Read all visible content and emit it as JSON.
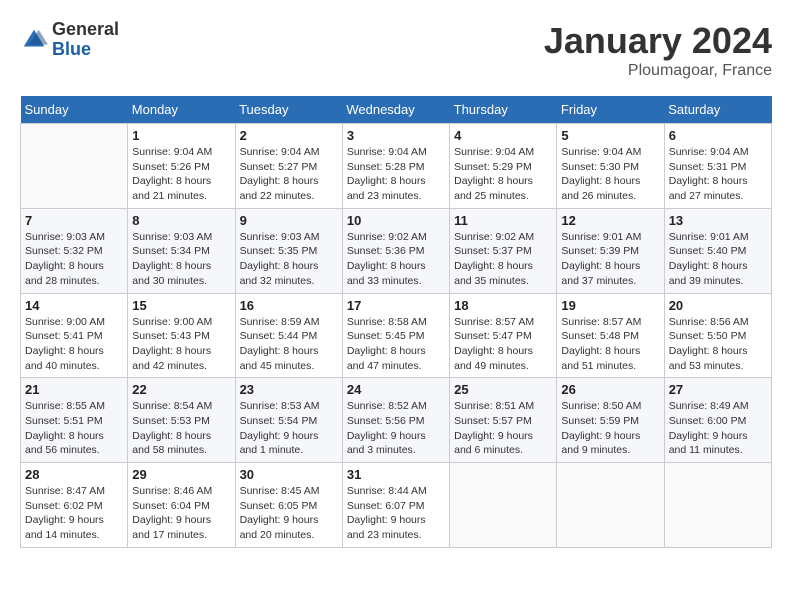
{
  "header": {
    "logo_general": "General",
    "logo_blue": "Blue",
    "month_title": "January 2024",
    "location": "Ploumagoar, France"
  },
  "weekdays": [
    "Sunday",
    "Monday",
    "Tuesday",
    "Wednesday",
    "Thursday",
    "Friday",
    "Saturday"
  ],
  "weeks": [
    [
      {
        "day": "",
        "info": ""
      },
      {
        "day": "1",
        "info": "Sunrise: 9:04 AM\nSunset: 5:26 PM\nDaylight: 8 hours\nand 21 minutes."
      },
      {
        "day": "2",
        "info": "Sunrise: 9:04 AM\nSunset: 5:27 PM\nDaylight: 8 hours\nand 22 minutes."
      },
      {
        "day": "3",
        "info": "Sunrise: 9:04 AM\nSunset: 5:28 PM\nDaylight: 8 hours\nand 23 minutes."
      },
      {
        "day": "4",
        "info": "Sunrise: 9:04 AM\nSunset: 5:29 PM\nDaylight: 8 hours\nand 25 minutes."
      },
      {
        "day": "5",
        "info": "Sunrise: 9:04 AM\nSunset: 5:30 PM\nDaylight: 8 hours\nand 26 minutes."
      },
      {
        "day": "6",
        "info": "Sunrise: 9:04 AM\nSunset: 5:31 PM\nDaylight: 8 hours\nand 27 minutes."
      }
    ],
    [
      {
        "day": "7",
        "info": "Sunrise: 9:03 AM\nSunset: 5:32 PM\nDaylight: 8 hours\nand 28 minutes."
      },
      {
        "day": "8",
        "info": "Sunrise: 9:03 AM\nSunset: 5:34 PM\nDaylight: 8 hours\nand 30 minutes."
      },
      {
        "day": "9",
        "info": "Sunrise: 9:03 AM\nSunset: 5:35 PM\nDaylight: 8 hours\nand 32 minutes."
      },
      {
        "day": "10",
        "info": "Sunrise: 9:02 AM\nSunset: 5:36 PM\nDaylight: 8 hours\nand 33 minutes."
      },
      {
        "day": "11",
        "info": "Sunrise: 9:02 AM\nSunset: 5:37 PM\nDaylight: 8 hours\nand 35 minutes."
      },
      {
        "day": "12",
        "info": "Sunrise: 9:01 AM\nSunset: 5:39 PM\nDaylight: 8 hours\nand 37 minutes."
      },
      {
        "day": "13",
        "info": "Sunrise: 9:01 AM\nSunset: 5:40 PM\nDaylight: 8 hours\nand 39 minutes."
      }
    ],
    [
      {
        "day": "14",
        "info": "Sunrise: 9:00 AM\nSunset: 5:41 PM\nDaylight: 8 hours\nand 40 minutes."
      },
      {
        "day": "15",
        "info": "Sunrise: 9:00 AM\nSunset: 5:43 PM\nDaylight: 8 hours\nand 42 minutes."
      },
      {
        "day": "16",
        "info": "Sunrise: 8:59 AM\nSunset: 5:44 PM\nDaylight: 8 hours\nand 45 minutes."
      },
      {
        "day": "17",
        "info": "Sunrise: 8:58 AM\nSunset: 5:45 PM\nDaylight: 8 hours\nand 47 minutes."
      },
      {
        "day": "18",
        "info": "Sunrise: 8:57 AM\nSunset: 5:47 PM\nDaylight: 8 hours\nand 49 minutes."
      },
      {
        "day": "19",
        "info": "Sunrise: 8:57 AM\nSunset: 5:48 PM\nDaylight: 8 hours\nand 51 minutes."
      },
      {
        "day": "20",
        "info": "Sunrise: 8:56 AM\nSunset: 5:50 PM\nDaylight: 8 hours\nand 53 minutes."
      }
    ],
    [
      {
        "day": "21",
        "info": "Sunrise: 8:55 AM\nSunset: 5:51 PM\nDaylight: 8 hours\nand 56 minutes."
      },
      {
        "day": "22",
        "info": "Sunrise: 8:54 AM\nSunset: 5:53 PM\nDaylight: 8 hours\nand 58 minutes."
      },
      {
        "day": "23",
        "info": "Sunrise: 8:53 AM\nSunset: 5:54 PM\nDaylight: 9 hours\nand 1 minute."
      },
      {
        "day": "24",
        "info": "Sunrise: 8:52 AM\nSunset: 5:56 PM\nDaylight: 9 hours\nand 3 minutes."
      },
      {
        "day": "25",
        "info": "Sunrise: 8:51 AM\nSunset: 5:57 PM\nDaylight: 9 hours\nand 6 minutes."
      },
      {
        "day": "26",
        "info": "Sunrise: 8:50 AM\nSunset: 5:59 PM\nDaylight: 9 hours\nand 9 minutes."
      },
      {
        "day": "27",
        "info": "Sunrise: 8:49 AM\nSunset: 6:00 PM\nDaylight: 9 hours\nand 11 minutes."
      }
    ],
    [
      {
        "day": "28",
        "info": "Sunrise: 8:47 AM\nSunset: 6:02 PM\nDaylight: 9 hours\nand 14 minutes."
      },
      {
        "day": "29",
        "info": "Sunrise: 8:46 AM\nSunset: 6:04 PM\nDaylight: 9 hours\nand 17 minutes."
      },
      {
        "day": "30",
        "info": "Sunrise: 8:45 AM\nSunset: 6:05 PM\nDaylight: 9 hours\nand 20 minutes."
      },
      {
        "day": "31",
        "info": "Sunrise: 8:44 AM\nSunset: 6:07 PM\nDaylight: 9 hours\nand 23 minutes."
      },
      {
        "day": "",
        "info": ""
      },
      {
        "day": "",
        "info": ""
      },
      {
        "day": "",
        "info": ""
      }
    ]
  ]
}
